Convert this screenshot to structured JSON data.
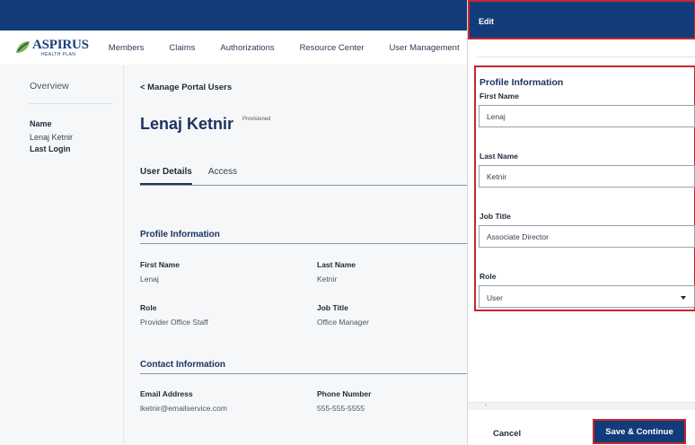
{
  "brand": {
    "name": "ASPIRUS",
    "tagline": "HEALTH PLAN"
  },
  "nav": [
    "Members",
    "Claims",
    "Authorizations",
    "Resource Center",
    "User Management"
  ],
  "sidebar": {
    "overview": "Overview",
    "name_label": "Name",
    "name_value": "Lenaj Ketnir",
    "last_login_label": "Last Login"
  },
  "main": {
    "back_link": "< Manage Portal Users",
    "user_name": "Lenaj Ketnir",
    "status": "Provisioned",
    "tabs": [
      "User Details",
      "Access"
    ],
    "profile_section": "Profile Information",
    "first_name_label": "First Name",
    "first_name_value": "Lenaj",
    "last_name_label": "Last Name",
    "last_name_value": "Ketnir",
    "role_label": "Role",
    "role_value": "Provider Office Staff",
    "job_title_label": "Job Title",
    "job_title_value": "Office Manager",
    "contact_section": "Contact Information",
    "email_label": "Email Address",
    "email_value": "lketnir@emailservice.com",
    "phone_label": "Phone Number",
    "phone_value": "555-555-5555"
  },
  "panel": {
    "header": "Edit",
    "section_title": "Profile Information",
    "first_name_label": "First Name",
    "first_name_value": "Lenaj",
    "last_name_label": "Last Name",
    "last_name_value": "Ketnir",
    "job_title_label": "Job Title",
    "job_title_value": "Associate Director",
    "role_label": "Role",
    "role_value": "User",
    "cancel": "Cancel",
    "save": "Save & Continue"
  },
  "colors": {
    "header_blue": "#123c79",
    "highlight_red": "#c6262e",
    "title_navy": "#1d3360"
  }
}
